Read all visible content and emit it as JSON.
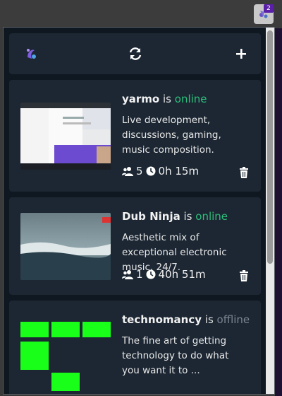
{
  "extension": {
    "badge_count": "2",
    "icon": "puzzle-icon"
  },
  "toolbar": {
    "logo_icon": "logo-icon",
    "refresh_icon": "refresh-icon",
    "add_icon": "plus-icon"
  },
  "streams": [
    {
      "name": "yarmo",
      "is": "is",
      "status": "online",
      "description": "Live development, discussions, gaming, music composition.",
      "viewers": "5",
      "duration": "0h 15m"
    },
    {
      "name": "Dub Ninja",
      "is": "is",
      "status": "online",
      "description": "Aesthetic mix of exceptional electronic music, 24/7.",
      "viewers": "1",
      "duration": "40h 51m"
    },
    {
      "name": "technomancy",
      "is": "is",
      "status": "offline",
      "description": "The fine art of getting technology to do what you want it to ..."
    }
  ],
  "colors": {
    "online": "#2dbf7a",
    "offline": "#7a8590",
    "card_bg": "#1c2733",
    "popup_bg": "#0f1720"
  }
}
